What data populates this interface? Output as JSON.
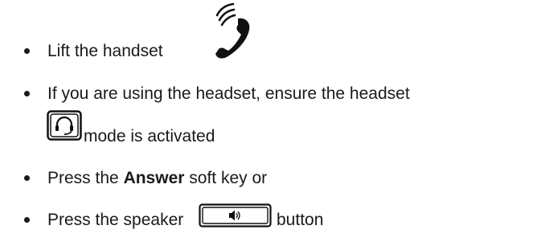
{
  "steps": [
    {
      "text": "Lift the handset",
      "icon": "ringing-handset-icon"
    },
    {
      "text": "If you are using the headset, ensure the headset",
      "continuation": "mode is activated",
      "icon": "headset-key-icon"
    },
    {
      "prefix": "Press the",
      "bold": "Answer",
      "suffix": "soft key or"
    },
    {
      "prefix": "Press the speaker",
      "suffix": "button",
      "icon": "speaker-key-icon"
    }
  ]
}
